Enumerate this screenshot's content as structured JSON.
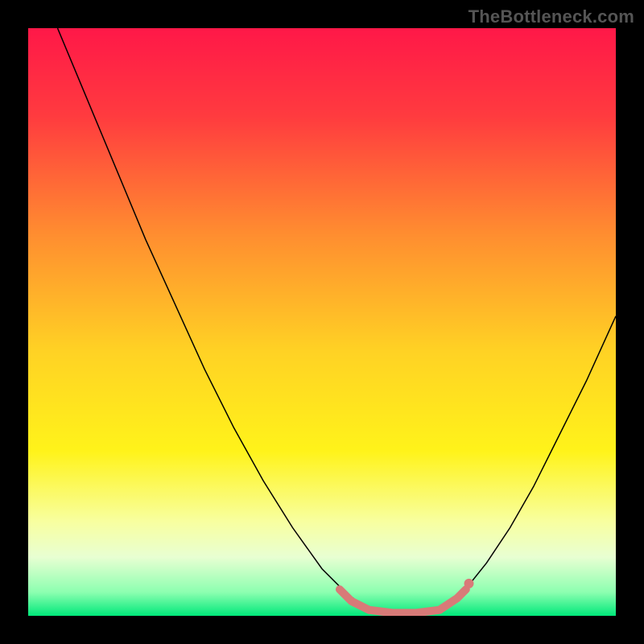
{
  "watermark": "TheBottleneck.com",
  "chart_data": {
    "type": "line",
    "title": "",
    "xlabel": "",
    "ylabel": "",
    "xlim": [
      0,
      100
    ],
    "ylim": [
      0,
      100
    ],
    "grid": false,
    "legend": false,
    "background_gradient": {
      "stops": [
        {
          "offset": 0.0,
          "color": "#ff1848"
        },
        {
          "offset": 0.15,
          "color": "#ff3b3f"
        },
        {
          "offset": 0.35,
          "color": "#ff8d30"
        },
        {
          "offset": 0.55,
          "color": "#ffd224"
        },
        {
          "offset": 0.72,
          "color": "#fff31a"
        },
        {
          "offset": 0.84,
          "color": "#f8ffa0"
        },
        {
          "offset": 0.9,
          "color": "#e8ffd2"
        },
        {
          "offset": 0.96,
          "color": "#8cffb0"
        },
        {
          "offset": 1.0,
          "color": "#00e87a"
        }
      ]
    },
    "series": [
      {
        "name": "bottleneck-curve",
        "color": "#000000",
        "width": 1.5,
        "points": [
          {
            "x": 5.0,
            "y": 100.0
          },
          {
            "x": 10.0,
            "y": 88.0
          },
          {
            "x": 15.0,
            "y": 76.0
          },
          {
            "x": 20.0,
            "y": 64.0
          },
          {
            "x": 25.0,
            "y": 53.0
          },
          {
            "x": 30.0,
            "y": 42.0
          },
          {
            "x": 35.0,
            "y": 32.0
          },
          {
            "x": 40.0,
            "y": 23.0
          },
          {
            "x": 45.0,
            "y": 15.0
          },
          {
            "x": 50.0,
            "y": 8.0
          },
          {
            "x": 54.0,
            "y": 4.0
          },
          {
            "x": 58.0,
            "y": 1.0
          },
          {
            "x": 62.0,
            "y": 0.0
          },
          {
            "x": 66.0,
            "y": 0.0
          },
          {
            "x": 70.0,
            "y": 1.0
          },
          {
            "x": 74.0,
            "y": 4.0
          },
          {
            "x": 78.0,
            "y": 9.0
          },
          {
            "x": 82.0,
            "y": 15.0
          },
          {
            "x": 86.0,
            "y": 22.0
          },
          {
            "x": 90.0,
            "y": 30.0
          },
          {
            "x": 95.0,
            "y": 40.0
          },
          {
            "x": 100.0,
            "y": 51.0
          }
        ]
      },
      {
        "name": "highlight-band",
        "color": "#d87a78",
        "width": 10,
        "linecap": "round",
        "points": [
          {
            "x": 53.0,
            "y": 4.5
          },
          {
            "x": 55.0,
            "y": 2.5
          },
          {
            "x": 58.0,
            "y": 1.0
          },
          {
            "x": 62.0,
            "y": 0.5
          },
          {
            "x": 66.0,
            "y": 0.5
          },
          {
            "x": 70.0,
            "y": 1.0
          },
          {
            "x": 73.0,
            "y": 3.0
          },
          {
            "x": 74.5,
            "y": 4.5
          }
        ]
      }
    ],
    "markers": [
      {
        "x": 75.0,
        "y": 5.5,
        "r": 6,
        "color": "#d87a78"
      }
    ]
  }
}
